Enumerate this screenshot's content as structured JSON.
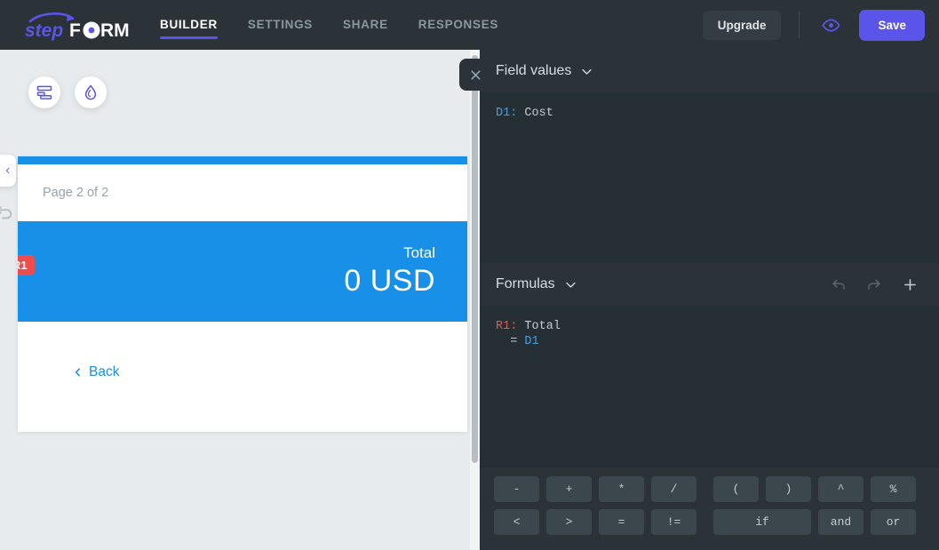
{
  "header": {
    "logo_text_1": "step",
    "logo_text_2": "FORM",
    "nav": [
      {
        "label": "BUILDER",
        "active": true
      },
      {
        "label": "SETTINGS",
        "active": false
      },
      {
        "label": "SHARE",
        "active": false
      },
      {
        "label": "RESPONSES",
        "active": false
      }
    ],
    "upgrade_label": "Upgrade",
    "preview_icon": "eye-icon",
    "save_label": "Save",
    "accent_purple": "#5a55e8",
    "bar_background": "#2b3338"
  },
  "canvas": {
    "tool_buttons": [
      {
        "icon": "form-layout-icon"
      },
      {
        "icon": "droplet-theme-icon"
      }
    ],
    "form": {
      "page_label": "Page 2 of 2",
      "progress_color": "#1890e8",
      "total_label": "Total",
      "total_value": "0 USD",
      "tag": "R1",
      "tag_color": "#ee4d4d",
      "back_label": "Back",
      "back_icon": "chevron-left-icon"
    }
  },
  "panel": {
    "close_icon": "close-icon",
    "field_values": {
      "title": "Field values",
      "chevron": "chevron-down-icon",
      "lines": [
        {
          "ref": "D1:",
          "ref_color": "blue",
          "text": " Cost"
        }
      ]
    },
    "formulas": {
      "title": "Formulas",
      "chevron": "chevron-down-icon",
      "undo_icon": "undo-icon",
      "redo_icon": "redo-icon",
      "add_icon": "plus-icon",
      "line1_ref": "R1:",
      "line1_text": " Total",
      "line2_prefix": "  = ",
      "line2_ref": "D1"
    },
    "operators": {
      "row1": [
        "-",
        "+",
        "*",
        "/",
        "(",
        ")",
        "^",
        "%"
      ],
      "row2": [
        "<",
        ">",
        "=",
        "!=",
        "if",
        "and",
        "or"
      ]
    }
  }
}
